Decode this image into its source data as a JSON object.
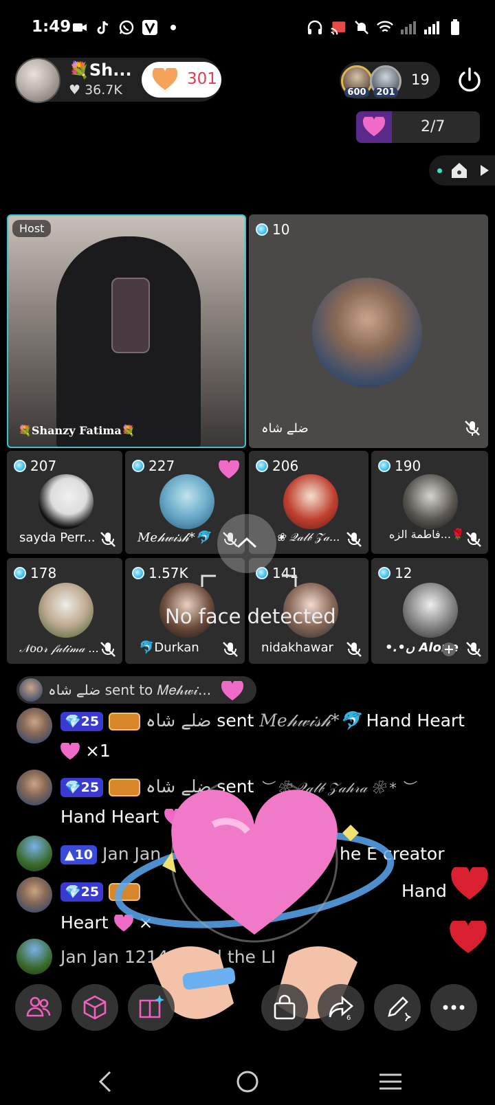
{
  "status_bar": {
    "time": "1:49"
  },
  "host": {
    "name": "💐Sh...",
    "likes": "36.7K",
    "heart_count": "301"
  },
  "viewers": {
    "avatar1_level": "600",
    "avatar2_level": "201",
    "count": "19"
  },
  "pager": {
    "label": "2/7"
  },
  "seats": {
    "host": {
      "tag": "Host",
      "name": "💐Shanzy Fatima💐"
    },
    "guest1": {
      "score": "10",
      "name": "ضلے شاہ"
    },
    "small": [
      {
        "score": "207",
        "name": "sayda Perr..."
      },
      {
        "score": "227",
        "name": "𝑀𝑒𝒽𝓌𝒾𝓈𝒽*🐬"
      },
      {
        "score": "206",
        "name": "❀ 𝒬𝒶𝓁𝒷 𝒵𝒶..."
      },
      {
        "score": "190",
        "name": "فاطمة الزه...🌹"
      },
      {
        "score": "178",
        "name": "𝒩𝑜𝑜𝓇 𝒻𝒶𝓉𝒾𝓂𝒶 ..."
      },
      {
        "score": "1.57K",
        "name": "🐬Durkan"
      },
      {
        "score": "141",
        "name": "nidakhawar"
      },
      {
        "score": "12",
        "name": "•.•ں Alone"
      }
    ]
  },
  "overlay": {
    "no_face": "No face detected"
  },
  "chat": {
    "notice": "ضلے شاہ sent to 𝑀𝑒𝒽𝓌𝒾...",
    "messages": [
      {
        "level": "25",
        "sender": "ضلے شاہ",
        "verb": "sent",
        "target": "𝑀𝑒𝒽𝓌𝒾𝓈𝒽*🐬",
        "gift": "Hand Heart",
        "qty": "×1"
      },
      {
        "level": "25",
        "sender": "ضلے شاہ",
        "verb": "sent",
        "target": "︶ ❀ 𝒬𝒶𝓁𝒷 𝒵𝒶𝒽𝓇𝒶 ❀ * ︶",
        "gift": "Hand Heart",
        "qty": "×1"
      },
      {
        "level": "10",
        "text_left": "Jan Jan",
        "text_right": "he E creator"
      },
      {
        "level": "25",
        "text_right": "Hand",
        "line2": "Heart",
        "qty": "×"
      },
      {
        "text": "Jan Jan 1214",
        "text_right": "l the LI"
      }
    ]
  },
  "toolbar": {
    "share_count": "6"
  }
}
